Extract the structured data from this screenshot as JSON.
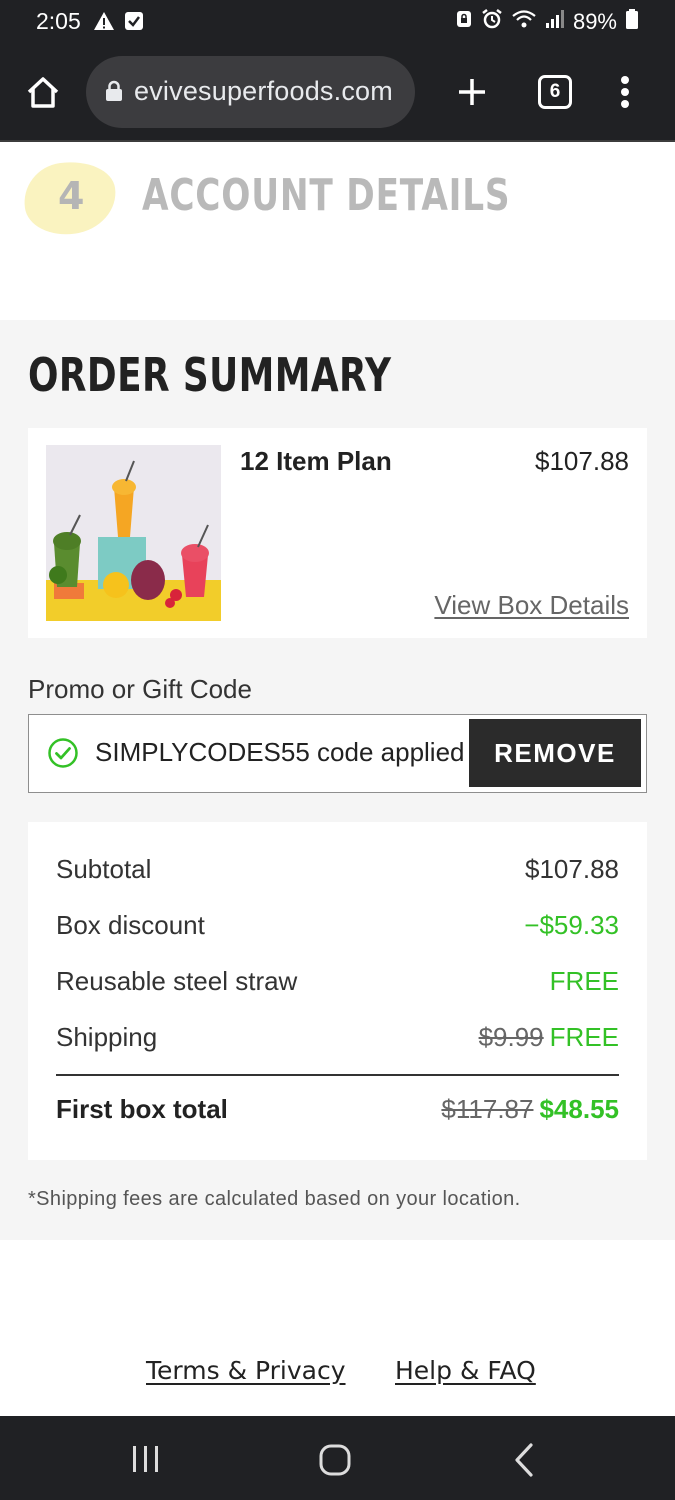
{
  "status_bar": {
    "time": "2:05",
    "battery": "89%",
    "left_icons": [
      "warning-icon",
      "checkbox-icon"
    ],
    "right_icons": [
      "lock-badge-icon",
      "alarm-icon",
      "wifi-icon",
      "signal-icon",
      "battery-icon"
    ]
  },
  "browser": {
    "url": "evivesuperfoods.com",
    "tab_count": "6"
  },
  "step": {
    "number": "4",
    "title": "ACCOUNT DETAILS"
  },
  "order_summary": {
    "title": "ORDER SUMMARY",
    "item": {
      "name": "12 Item Plan",
      "price": "$107.88",
      "view_details_label": "View Box Details"
    },
    "promo": {
      "label": "Promo or Gift Code",
      "applied_text": "SIMPLYCODES55 code applied",
      "remove_label": "REMOVE"
    },
    "totals": {
      "subtotal_label": "Subtotal",
      "subtotal_value": "$107.88",
      "discount_label": "Box discount",
      "discount_value": "−$59.33",
      "straw_label": "Reusable steel straw",
      "straw_value": "FREE",
      "shipping_label": "Shipping",
      "shipping_old": "$9.99",
      "shipping_value": "FREE",
      "total_label": "First box total",
      "total_old": "$117.87",
      "total_value": "$48.55"
    },
    "shipping_note": "*Shipping fees are calculated based on your location."
  },
  "footer": {
    "terms_label": "Terms & Privacy",
    "help_label": "Help & FAQ"
  },
  "colors": {
    "accent_green": "#33c126",
    "dark_bar": "#202124",
    "step_highlight": "#faf3c0"
  }
}
